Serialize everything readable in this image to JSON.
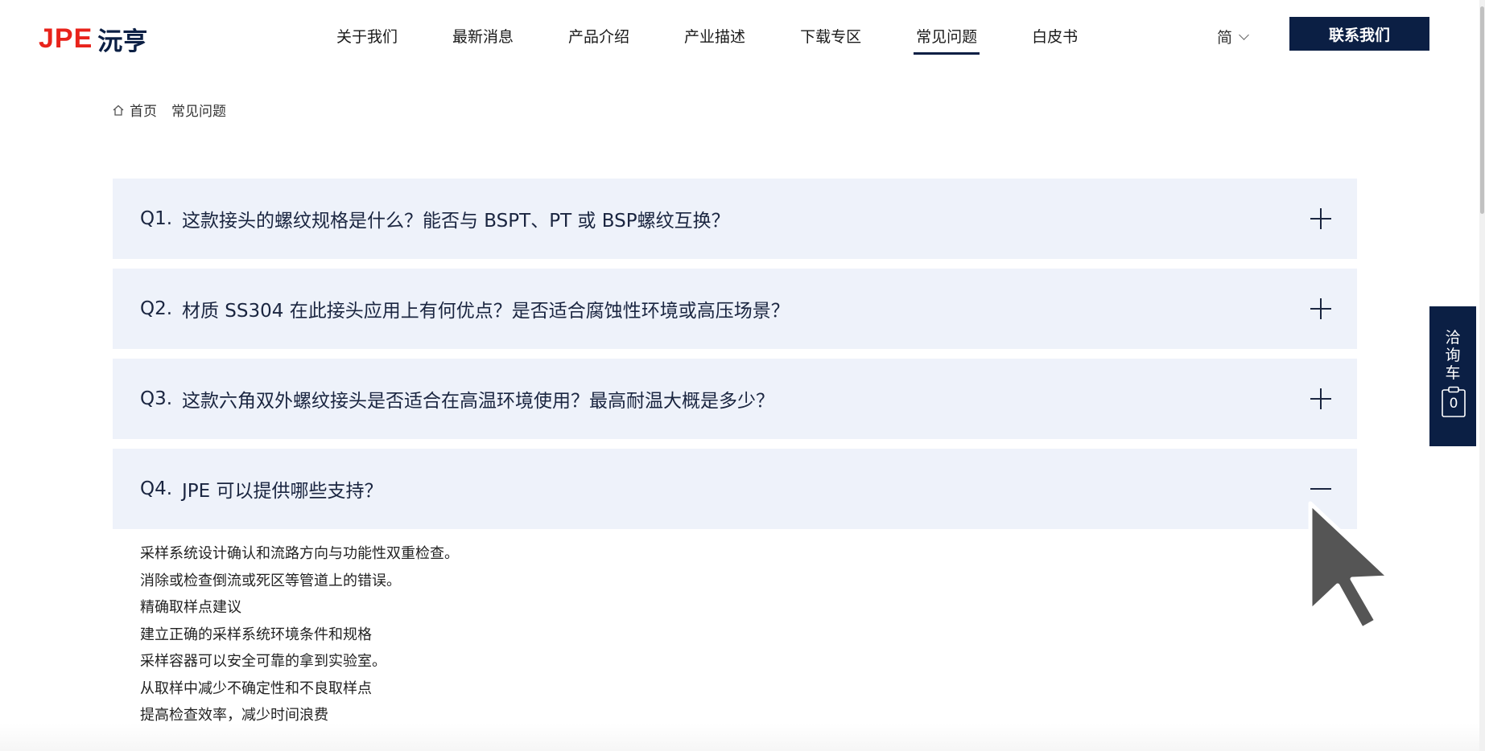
{
  "logo": {
    "brand": "JPE",
    "name": "沅亨"
  },
  "nav": {
    "items": [
      {
        "label": "关于我们"
      },
      {
        "label": "最新消息"
      },
      {
        "label": "产品介绍"
      },
      {
        "label": "产业描述"
      },
      {
        "label": "下载专区"
      },
      {
        "label": "常见问题",
        "active": true
      },
      {
        "label": "白皮书"
      }
    ],
    "language": "简",
    "contact_label": "联系我们"
  },
  "breadcrumb": {
    "home": "首页",
    "current": "常见问题"
  },
  "faq": [
    {
      "num": "Q1.",
      "question": "这款接头的螺纹规格是什么？能否与 BSPT、PT 或 BSP螺纹互换？",
      "expanded": false
    },
    {
      "num": "Q2.",
      "question": "材质 SS304 在此接头应用上有何优点？是否适合腐蚀性环境或高压场景？",
      "expanded": false
    },
    {
      "num": "Q3.",
      "question": "这款六角双外螺纹接头是否适合在高温环境使用？最高耐温大概是多少？",
      "expanded": false
    },
    {
      "num": "Q4.",
      "question": "JPE 可以提供哪些支持？",
      "expanded": true
    }
  ],
  "answer_q4": [
    "采样系统设计确认和流路方向与功能性双重检查。",
    "消除或检查倒流或死区等管道上的错误。",
    "精确取样点建议",
    "建立正确的采样系统环境条件和规格",
    "采样容器可以安全可靠的拿到实验室。",
    "从取样中减少不确定性和不良取样点",
    "提高检查效率，减少时间浪费"
  ],
  "side_cart": {
    "label": "洽询车",
    "count": "0"
  },
  "colors": {
    "brand_red": "#e8231b",
    "navy": "#0b1f44",
    "faq_bg": "#eef2fa"
  }
}
